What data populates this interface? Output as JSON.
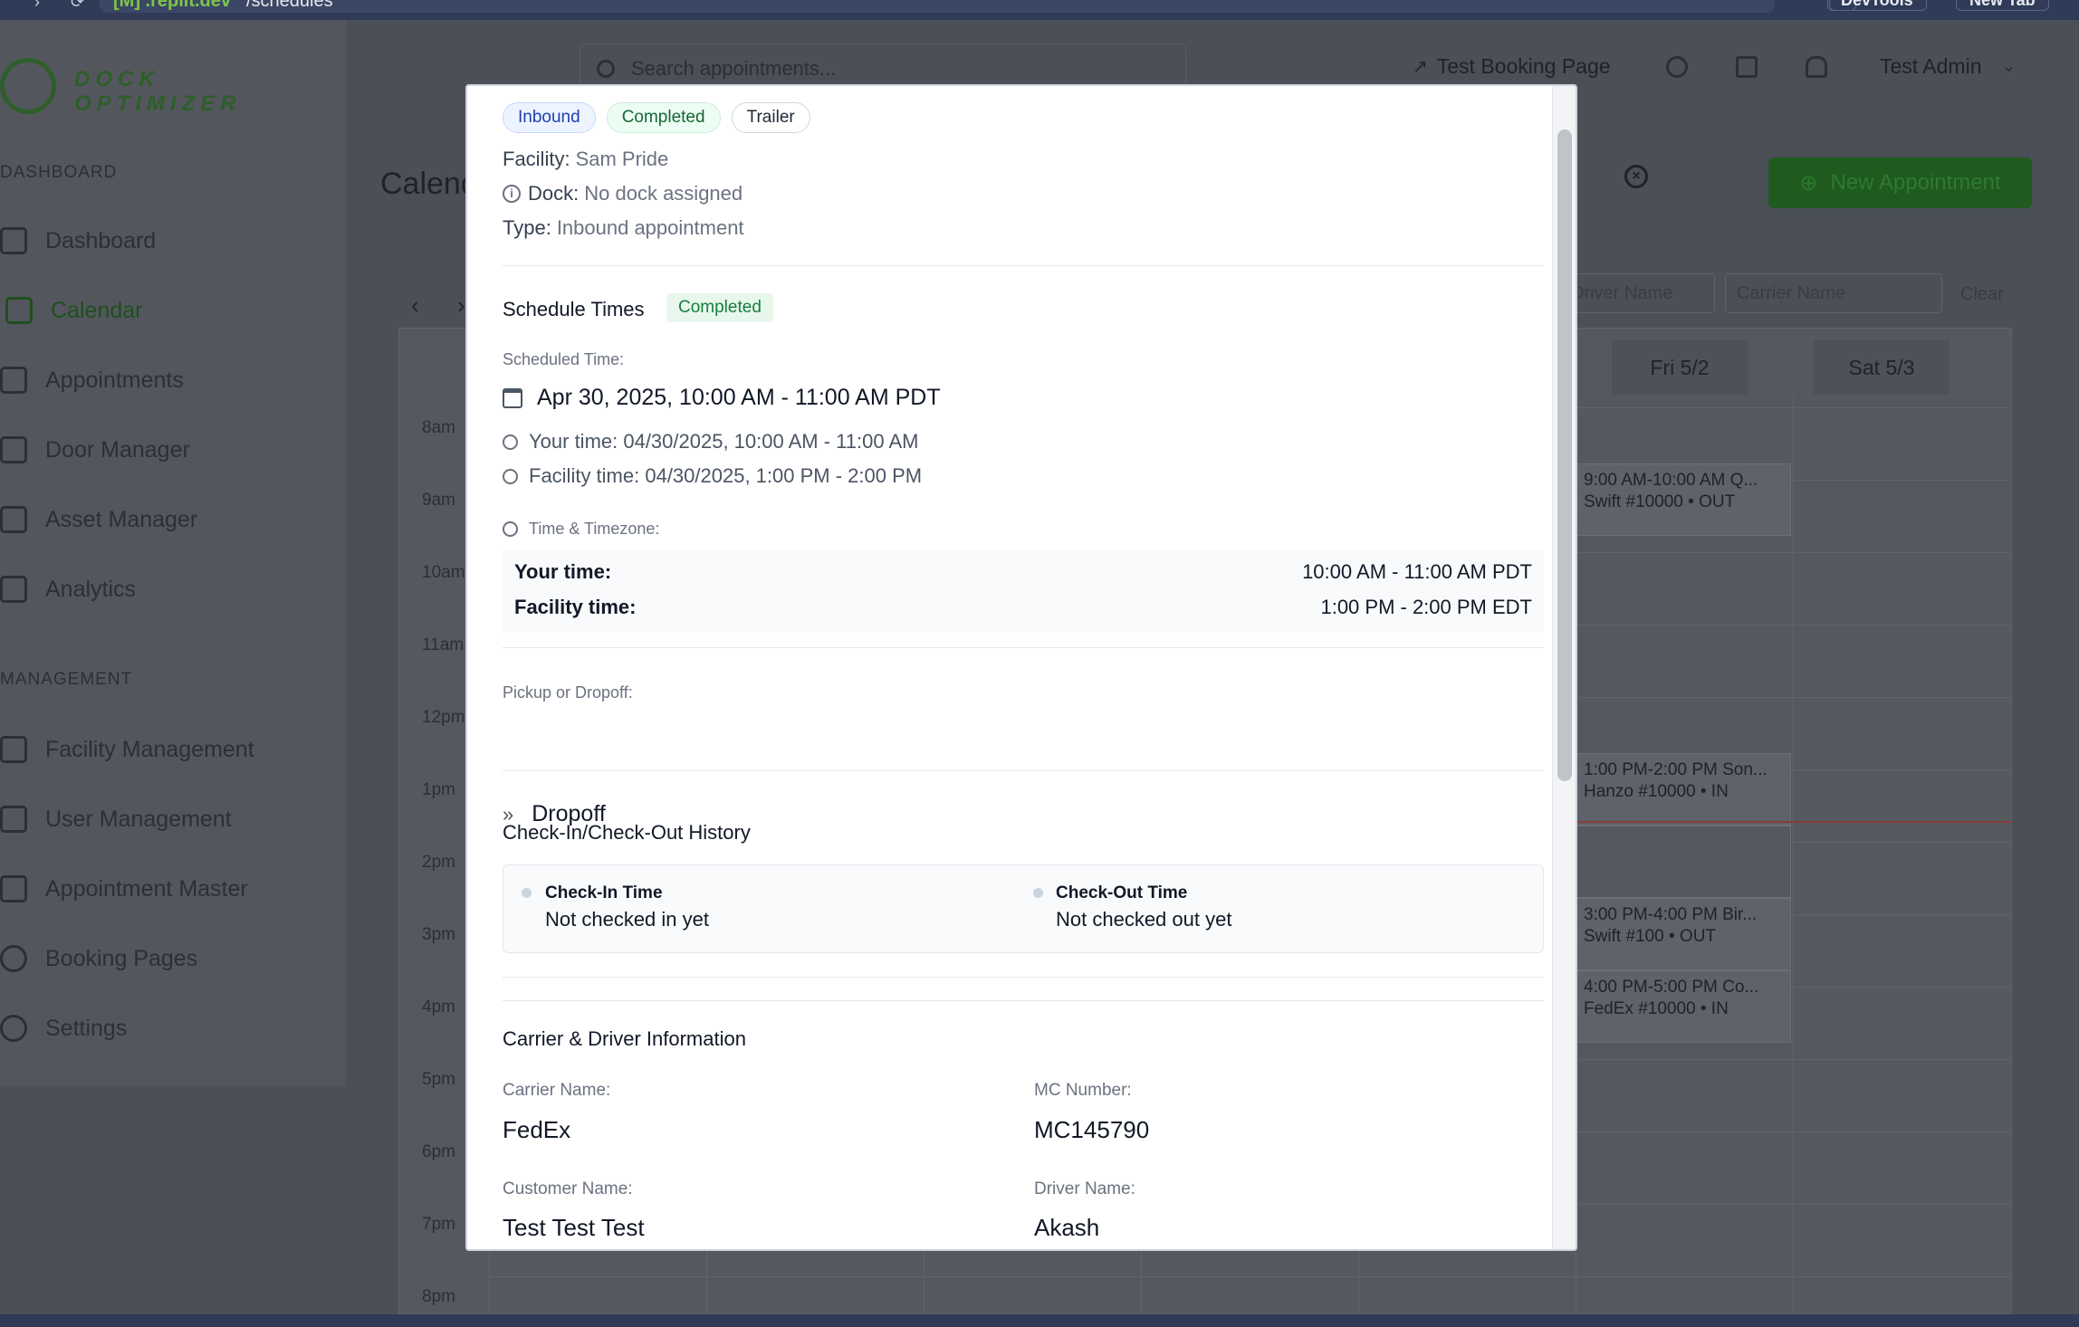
{
  "browser": {
    "url_tag": "[M] .replit.dev",
    "url_path": "/schedules",
    "devtools_label": "DevTools",
    "new_tab_label": "New Tab"
  },
  "sidebar": {
    "logo_line1": "DOCK",
    "logo_line2": "OPTIMIZER",
    "dashboard_section": "DASHBOARD",
    "management_section": "MANAGEMENT",
    "items": [
      {
        "label": "Dashboard"
      },
      {
        "label": "Calendar"
      },
      {
        "label": "Appointments"
      },
      {
        "label": "Door Manager"
      },
      {
        "label": "Asset Manager"
      },
      {
        "label": "Analytics"
      },
      {
        "label": "Facility Management"
      },
      {
        "label": "User Management"
      },
      {
        "label": "Appointment Master"
      },
      {
        "label": "Booking Pages"
      },
      {
        "label": "Settings"
      }
    ]
  },
  "header": {
    "search_placeholder": "Search appointments...",
    "test_booking_label": "Test Booking Page",
    "user_name": "Test Admin"
  },
  "page": {
    "title": "Calendar",
    "new_appointment_label": "New Appointment",
    "filter_driver_placeholder": "Driver Name",
    "filter_carrier_placeholder": "Carrier Name",
    "clear_label": "Clear",
    "days": [
      "Fri 5/2",
      "Sat 5/3"
    ],
    "hours": [
      "8am",
      "9am",
      "10am",
      "11am",
      "12pm",
      "1pm",
      "2pm",
      "3pm",
      "4pm",
      "5pm",
      "6pm",
      "7pm",
      "8pm"
    ],
    "events": [
      {
        "line1": "9:00 AM-10:00 AM Q...",
        "line2": "Swift #10000 • OUT"
      },
      {
        "line1": "1:00 PM-2:00 PM Son...",
        "line2": "Hanzo #10000 • IN"
      },
      {
        "line1": "3:00 PM-4:00 PM Bir...",
        "line2": "Swift #100 • OUT"
      },
      {
        "line1": "4:00 PM-5:00 PM Co...",
        "line2": "FedEx #10000 • IN"
      }
    ]
  },
  "modal": {
    "badges": [
      "Inbound",
      "Completed",
      "Trailer"
    ],
    "facility_label": "Facility:",
    "facility_value": "Sam Pride",
    "dock_label": "Dock:",
    "dock_value": "No dock assigned",
    "type_label": "Type:",
    "type_value": "Inbound appointment",
    "schedule_title": "Schedule Times",
    "schedule_status": "Completed",
    "scheduled_time_label": "Scheduled Time:",
    "scheduled_time_value": "Apr 30, 2025, 10:00 AM - 11:00 AM PDT",
    "your_time_line": "Your time: 04/30/2025, 10:00 AM - 11:00 AM",
    "facility_time_line": "Facility time: 04/30/2025, 1:00 PM - 2:00 PM",
    "tz_label": "Time & Timezone:",
    "tz_your_label": "Your time:",
    "tz_your_value": "10:00 AM - 11:00 AM PDT",
    "tz_facility_label": "Facility time:",
    "tz_facility_value": "1:00 PM - 2:00 PM EDT",
    "pickup_label": "Pickup or Dropoff:",
    "pickup_value": "Dropoff",
    "history_title": "Check-In/Check-Out History",
    "checkin_title": "Check-In Time",
    "checkin_value": "Not checked in yet",
    "checkout_title": "Check-Out Time",
    "checkout_value": "Not checked out yet",
    "carrier_section_title": "Carrier & Driver Information",
    "carrier_name_label": "Carrier Name:",
    "carrier_name_value": "FedEx",
    "mc_label": "MC Number:",
    "mc_value": "MC145790",
    "customer_label": "Customer Name:",
    "customer_value": "Test Test Test",
    "driver_label": "Driver Name:",
    "driver_value": "Akash"
  },
  "colors": {
    "brand_green": "#1f5a1f",
    "badge_blue": "#1e40af",
    "badge_green": "#15803d"
  }
}
